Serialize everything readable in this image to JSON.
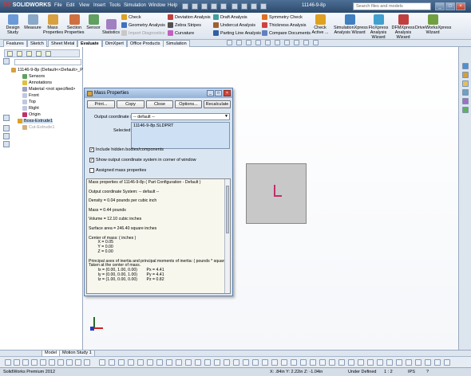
{
  "titlebar": {
    "brand": "SOLIDWORKS",
    "menus": [
      "File",
      "Edit",
      "View",
      "Insert",
      "Tools",
      "Simulation",
      "Window",
      "Help"
    ],
    "doc_title": "11146-9-8p",
    "search_placeholder": "Search files and models",
    "minimize": "_",
    "restore": "□",
    "close": "×"
  },
  "cmdmgr": {
    "big": [
      "Design Study",
      "Measure",
      "Mass Properties",
      "Section Properties",
      "Sensor",
      "Statistics"
    ],
    "col1": [
      "Check",
      "Geometry Analysis",
      "Import Diagnostics"
    ],
    "col2": [
      "Deviation Analysis",
      "Zebra Stripes",
      "Curvature"
    ],
    "col3": [
      "Draft Analysis",
      "Undercut Analysis",
      "Parting Line Analysis"
    ],
    "col4": [
      "Symmetry Check",
      "Thickness Analysis",
      "Compare Documents"
    ],
    "check_active": "Check Active ...",
    "addins": [
      "SimulationXpress Analysis Wizard",
      "FloXpress Analysis Wizard",
      "DFMXpress Analysis Wizard",
      "DriveWorksXpress Wizard"
    ]
  },
  "cmtabs": [
    "Features",
    "Sketch",
    "Sheet Metal",
    "Evaluate",
    "DimXpert",
    "Office Products",
    "Simulation"
  ],
  "tree": {
    "root": "11146-9-8p (Default<<Default>_Pho",
    "items": [
      "Sensors",
      "Annotations",
      "Material <not specified>",
      "Front",
      "Top",
      "Right",
      "Origin",
      "Boss-Extrude1",
      "Cut-Extrude1"
    ]
  },
  "dialog": {
    "title": "Mass Properties",
    "buttons": [
      "Print...",
      "Copy",
      "Close",
      "Options...",
      "Recalculate"
    ],
    "coord_label": "Output coordinate system:",
    "coord_value": "-- default --",
    "selected_label": "Selected items:",
    "selected_value": "11146-9-8p.SLDPRT",
    "checks": [
      {
        "label": "Include hidden bodies/components",
        "checked": true
      },
      {
        "label": "Show output coordinate system in corner of window",
        "checked": true
      },
      {
        "label": "Assigned mass properties",
        "checked": false
      }
    ],
    "checkmark": "✓",
    "results": [
      "Mass properties of 11146-9-8p ( Part Configuration - Default )",
      "",
      "Output coordinate System: -- default --",
      "",
      "Density = 0.04 pounds per cubic inch",
      "",
      "Mass = 0.44 pounds",
      "",
      "Volume = 12.10 cubic inches",
      "",
      "Surface area = 246.40 square inches",
      "",
      "Center of mass: ( inches )",
      "        X = 0.05",
      "        Y = 0.00",
      "        Z = 0.00",
      "",
      "Principal axes of inertia and principal moments of inertia: ( pounds * square inc",
      "Taken at the center of mass.",
      "        Ix = (0.00, 1.00, 0.00)        Px = 4.41",
      "        Iy = (0.00, 0.00, 1.00)        Py = 4.41",
      "        Iz = (1.00, 0.00, 0.00)        Pz = 0.82"
    ]
  },
  "modeltabs": [
    "Model",
    "Motion Study 1"
  ],
  "status": {
    "product": "SolidWorks Premium 2012",
    "coords": "X: .84in Y: 2.22in Z: -1.04in",
    "state": "Under Defined",
    "scale": "1 : 2",
    "units": "IPS",
    "help": "?"
  },
  "colors": {
    "title_bg": "#2c4a6c",
    "dialog_bg": "#dbe6f3",
    "part_fill": "#c8c8c8",
    "origin": "#c0306a"
  }
}
